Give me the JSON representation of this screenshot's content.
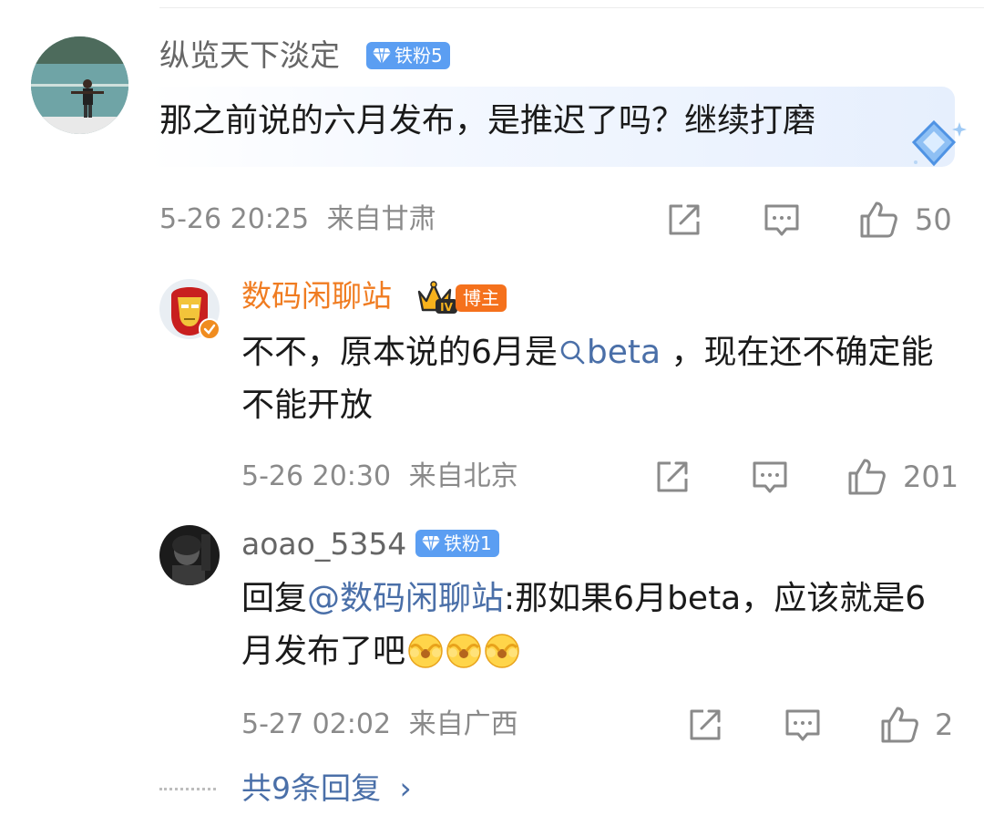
{
  "comment": {
    "username": "纵览天下淡定",
    "badge": "铁粉5",
    "text": "那之前说的六月发布，是推迟了吗？继续打磨",
    "time": "5-26 20:25",
    "location": "来自甘肃",
    "likes": "50"
  },
  "replies": [
    {
      "username": "数码闲聊站",
      "level": "IV",
      "badge": "博主",
      "text_before": "不不，原本说的6月是",
      "link": "beta",
      "text_after": " ，现在还不确定能不能开放",
      "time": "5-26 20:30",
      "location": "来自北京",
      "likes": "201"
    },
    {
      "username": "aoao_5354",
      "badge": "铁粉1",
      "reply_prefix": "回复",
      "mention": "@数码闲聊站",
      "text": ":那如果6月beta，应该就是6月发布了吧",
      "time": "5-27 02:02",
      "location": "来自广西",
      "likes": "2"
    }
  ],
  "more_replies": "共9条回复",
  "more_chevron": "›",
  "colors": {
    "username_gray": "#666666",
    "blogger_orange": "#f07c21",
    "link_blue": "#4a6fa8",
    "badge_blue": "#5b9ef2",
    "meta_gray": "#8a8a8a"
  },
  "icons": [
    "share-icon",
    "comment-icon",
    "like-icon",
    "diamond-icon",
    "search-icon",
    "crown-icon",
    "verified-icon",
    "emoji-icon",
    "chevron-right-icon"
  ]
}
